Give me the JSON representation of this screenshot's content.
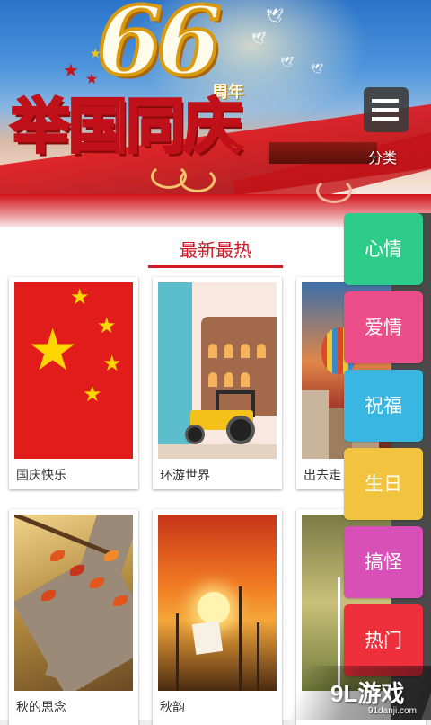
{
  "banner": {
    "number": "66",
    "anniversary_label": "周年",
    "headline": "举国同庆"
  },
  "category_button": {
    "icon": "list-menu-icon",
    "label": "分类"
  },
  "section": {
    "title": "最新最热"
  },
  "cards": [
    {
      "caption": "国庆快乐"
    },
    {
      "caption": "环游世界"
    },
    {
      "caption": "出去走"
    },
    {
      "caption": "秋的思念"
    },
    {
      "caption": "秋韵"
    },
    {
      "caption": ""
    }
  ],
  "tabs": [
    {
      "label": "心情",
      "color": "#2ecc8a"
    },
    {
      "label": "爱情",
      "color": "#ec4e8a"
    },
    {
      "label": "祝福",
      "color": "#3ab6e3"
    },
    {
      "label": "生日",
      "color": "#f2c33e"
    },
    {
      "label": "搞怪",
      "color": "#d84fb8"
    },
    {
      "label": "热门",
      "color": "#ee2f3c"
    }
  ],
  "watermark": {
    "logo_mark": "9L",
    "logo_text": "游戏",
    "url": "91danji.com"
  },
  "colors": {
    "accent": "#d11923"
  }
}
